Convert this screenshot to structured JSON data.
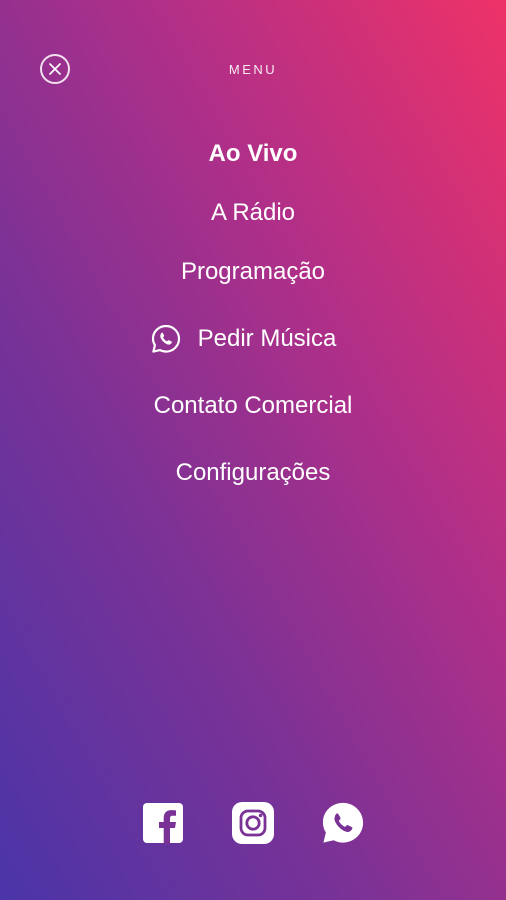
{
  "header": {
    "title": "MENU"
  },
  "icons": {
    "close": "close-icon",
    "whatsapp": "whatsapp-icon",
    "facebook": "facebook-icon",
    "instagram": "instagram-icon"
  },
  "menu": {
    "items": [
      {
        "label": "Ao Vivo",
        "active": true
      },
      {
        "label": "A Rádio"
      },
      {
        "label": "Programação"
      },
      {
        "label": "Pedir Música",
        "icon": "whatsapp-icon"
      },
      {
        "label": "Contato Comercial"
      },
      {
        "label": "Configurações"
      }
    ]
  },
  "colors": {
    "gradient_top": "#ee3268",
    "gradient_bottom": "#4a35a8",
    "text": "#ffffff"
  }
}
